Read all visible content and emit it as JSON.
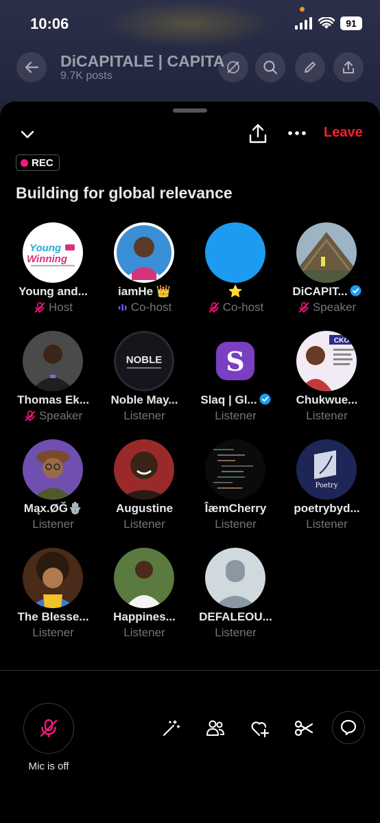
{
  "status_bar": {
    "time": "10:06",
    "battery": "91"
  },
  "profile": {
    "title": "DiCAPITALE | CAPITA",
    "subtitle": "9.7K posts"
  },
  "space": {
    "leave_label": "Leave",
    "rec_label": "REC",
    "title": "Building for global relevance"
  },
  "participants": [
    {
      "name": "Young and...",
      "role": "Host",
      "role_icon": "mic-off-icon",
      "avatar_color": "#ffffff",
      "avatar_text": "Young Winning"
    },
    {
      "name": "iamHe 👑",
      "role": "Co-host",
      "role_icon": "speaking-icon",
      "avatar_color": "#3a8fd6",
      "avatar_text": ""
    },
    {
      "name": "⭐",
      "role": "Co-host",
      "role_icon": "mic-off-icon",
      "avatar_color": "#1d9bf0",
      "avatar_text": ""
    },
    {
      "name": "DiCAPIT...",
      "role": "Speaker",
      "role_icon": "mic-off-icon",
      "avatar_color": "#6d7a80",
      "avatar_text": "",
      "verified": true
    },
    {
      "name": "Thomas Ek...",
      "role": "Speaker",
      "role_icon": "mic-off-icon",
      "avatar_color": "#3a3a3a",
      "avatar_text": ""
    },
    {
      "name": "Noble May...",
      "role": "Listener",
      "role_icon": "",
      "avatar_color": "#1a1a22",
      "avatar_text": "NOBLE"
    },
    {
      "name": "Slaq | Gl...",
      "role": "Listener",
      "role_icon": "",
      "avatar_color": "#000000",
      "avatar_text": "S",
      "verified": true
    },
    {
      "name": "Chukwue...",
      "role": "Listener",
      "role_icon": "",
      "avatar_color": "#e8d7f0",
      "avatar_text": "CKO"
    },
    {
      "name": "Mąx.ØĞ🪬",
      "role": "Listener",
      "role_icon": "",
      "avatar_color": "#7b5fb8",
      "avatar_text": ""
    },
    {
      "name": "Augustine",
      "role": "Listener",
      "role_icon": "",
      "avatar_color": "#8a2a2a",
      "avatar_text": ""
    },
    {
      "name": "ÎæmCherry",
      "role": "Listener",
      "role_icon": "",
      "avatar_color": "#0b0b0b",
      "avatar_text": ""
    },
    {
      "name": "poetrybyd...",
      "role": "Listener",
      "role_icon": "",
      "avatar_color": "#1d2656",
      "avatar_text": "Poetry"
    },
    {
      "name": "The Blesse...",
      "role": "Listener",
      "role_icon": "",
      "avatar_color": "#6b3b1e",
      "avatar_text": ""
    },
    {
      "name": "Happines...",
      "role": "Listener",
      "role_icon": "",
      "avatar_color": "#4f7a3a",
      "avatar_text": ""
    },
    {
      "name": "DEFALEOU...",
      "role": "Listener",
      "role_icon": "",
      "avatar_color": "#cfd9de",
      "avatar_text": ""
    }
  ],
  "controls": {
    "mic_label": "Mic is off"
  },
  "colors": {
    "leave": "#f4212e",
    "rec_dot": "#f91880",
    "verified": "#1d9bf0",
    "mic_off": "#f91880",
    "muted_text": "#71767b"
  }
}
